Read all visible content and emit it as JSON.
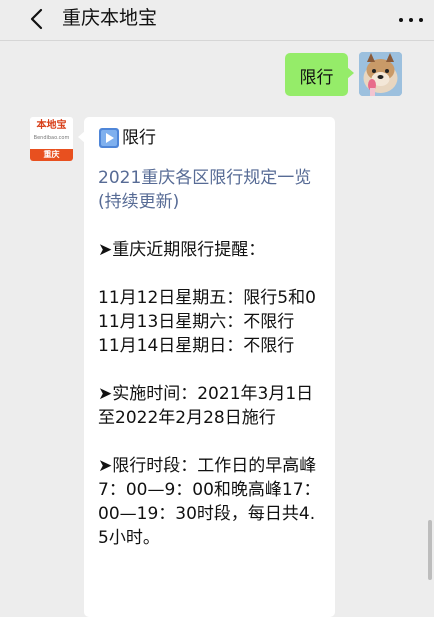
{
  "header": {
    "title": "重庆本地宝",
    "back_icon": "chevron-left-icon",
    "more_icon": "more-dots-icon"
  },
  "outgoing": {
    "text": "限行",
    "bubble_color": "#95ec69"
  },
  "incoming": {
    "avatar": {
      "logo_text": "本地宝",
      "logo_sub": "Bendibao.com",
      "city": "重庆"
    },
    "header_text": "限行",
    "play_icon": "play-square-icon",
    "link_text": "2021重庆各区限行规定一览(持续更新)",
    "reminder_title": "➤重庆近期限行提醒：",
    "reminders": [
      "11月12日星期五：限行5和0",
      "11月13日星期六：不限行",
      "11月14日星期日：不限行"
    ],
    "period_text": "➤实施时间：2021年3月1日至2022年2月28日施行",
    "hours_text": "➤限行时段：工作日的早高峰7：00—9：00和晚高峰17：00—19：30时段，每日共4.5小时。",
    "link_color": "#576b95"
  }
}
